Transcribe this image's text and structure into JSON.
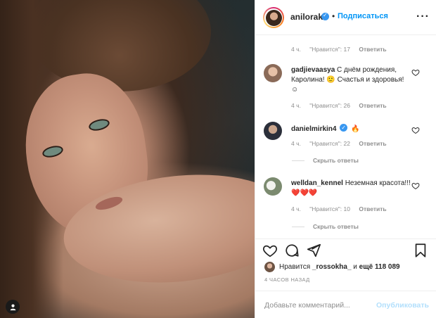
{
  "header": {
    "username": "anilorak",
    "separator": "•",
    "follow_label": "Подписаться",
    "more_icon": "more-horizontal-icon"
  },
  "comments": {
    "top_meta": {
      "time": "4 ч.",
      "likes": "\"Нравится\": 17",
      "reply": "Ответить"
    },
    "items": [
      {
        "username": "gadjievaasya",
        "text": "С днём рождения, Каролина! 🙂 Счастья и здоровья!☺",
        "time": "4 ч.",
        "likes": "\"Нравится\": 26",
        "reply": "Ответить"
      },
      {
        "username": "danielmirkin4",
        "text": "🔥",
        "time": "4 ч.",
        "likes": "\"Нравится\": 22",
        "reply": "Ответить",
        "hide_replies": "Скрыть ответы"
      },
      {
        "username": "welldan_kennel",
        "text": "Неземная красота!!!❤️❤️❤️",
        "time": "4 ч.",
        "likes": "\"Нравится\": 10",
        "reply": "Ответить",
        "hide_replies": "Скрыть ответы"
      }
    ]
  },
  "likes": {
    "prefix": "Нравится",
    "user": "_rossokha_",
    "conj": "и",
    "rest": "ещё 118 089"
  },
  "timestamp": "4 ЧАСОВ НАЗАД",
  "add_comment": {
    "placeholder": "Добавьте комментарий...",
    "publish_label": "Опубликовать"
  },
  "colors": {
    "accent": "#0095f6",
    "verified": "#3897f0",
    "muted": "#8e8e8e",
    "publish_disabled": "#b2dffc",
    "border": "#efefef"
  }
}
